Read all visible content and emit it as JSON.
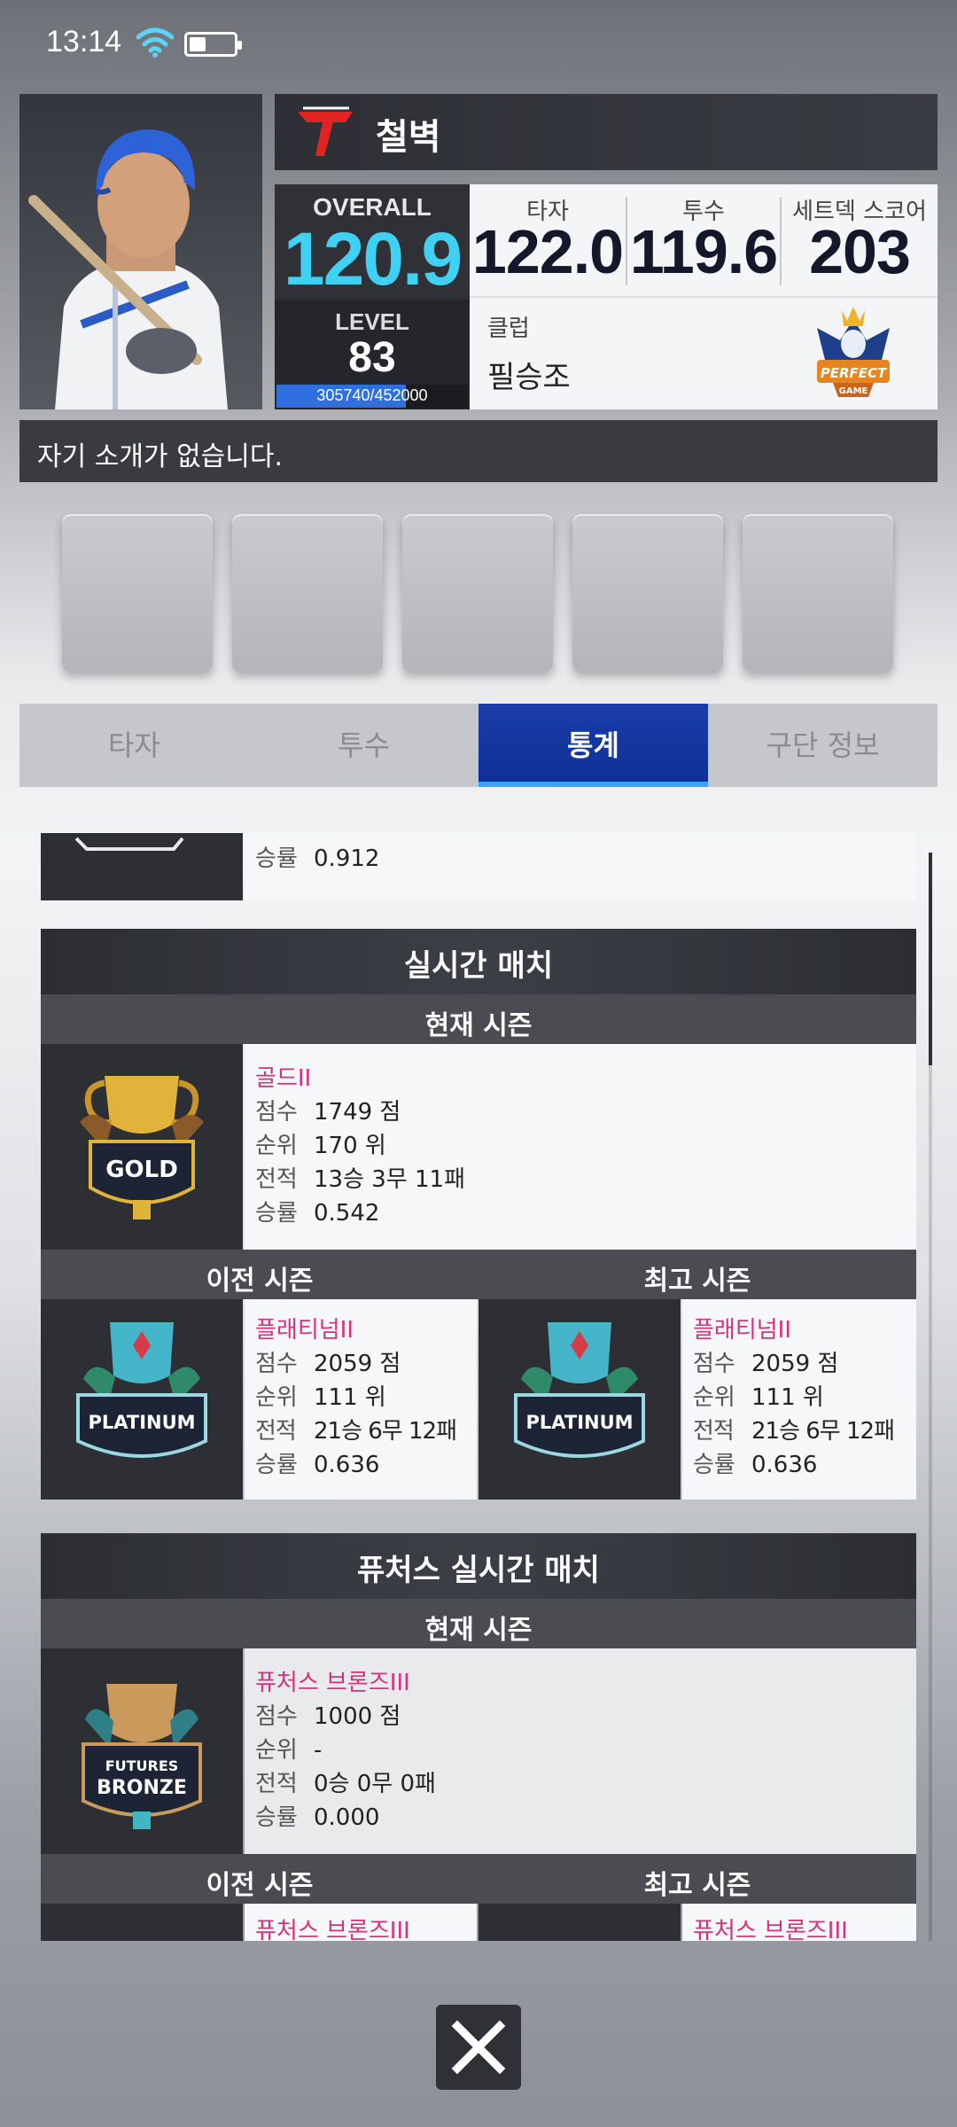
{
  "status": {
    "time": "13:14"
  },
  "player": {
    "name": "철벽",
    "overall_label": "OVERALL",
    "overall": "120.9",
    "level_label": "LEVEL",
    "level": "83",
    "exp_text": "305740/452000",
    "exp_fraction": 0.676
  },
  "stats": {
    "batter_label": "타자",
    "batter_value": "122.0",
    "pitcher_label": "투수",
    "pitcher_value": "119.6",
    "setdeck_label": "세트덱 스코어",
    "setdeck_value": "203",
    "club_label": "클럽",
    "club_name": "필승조"
  },
  "intro": "자기 소개가 없습니다.",
  "tabs": [
    "타자",
    "투수",
    "통계",
    "구단 정보"
  ],
  "active_tab": 2,
  "prev_card": {
    "winrate_key": "승률",
    "winrate": "0.912"
  },
  "realtime": {
    "title": "실시간 매치",
    "current_label": "현재 시즌",
    "current": {
      "rank": "골드II",
      "score": "1749 점",
      "position": "170 위",
      "record": "13승 3무 11패",
      "winrate": "0.542"
    },
    "previous_label": "이전 시즌",
    "best_label": "최고 시즌",
    "previous": {
      "rank": "플래티넘II",
      "score": "2059 점",
      "position": "111 위",
      "record": "21승 6무 12패",
      "winrate": "0.636"
    },
    "best": {
      "rank": "플래티넘II",
      "score": "2059 점",
      "position": "111 위",
      "record": "21승 6무 12패",
      "winrate": "0.636"
    }
  },
  "futures": {
    "title": "퓨처스 실시간 매치",
    "current_label": "현재 시즌",
    "current": {
      "rank": "퓨처스 브론즈III",
      "score": "1000 점",
      "position": "-",
      "record": "0승 0무 0패",
      "winrate": "0.000"
    },
    "previous_label": "이전 시즌",
    "best_label": "최고 시즌",
    "previous": {
      "rank": "퓨처스 브론즈III"
    },
    "best": {
      "rank": "퓨처스 브론즈III"
    }
  },
  "keys": {
    "score": "점수",
    "position": "순위",
    "record": "전적",
    "winrate": "승률"
  },
  "badges": {
    "gold": {
      "text": "GOLD",
      "color": "#e2b33a"
    },
    "platinum": {
      "text": "PLATINUM",
      "color": "#45b6c9"
    },
    "futures_bronze_1": "FUTURES",
    "futures_bronze_2": "BRONZE"
  },
  "club_emblem": {
    "line1": "PERFECT",
    "line2": "GAME"
  },
  "colors": {
    "accent": "#3fd0f2",
    "tab_active": "#0f2f95",
    "rank_text": "#d6317e"
  },
  "icons": {
    "close": "close-icon"
  }
}
